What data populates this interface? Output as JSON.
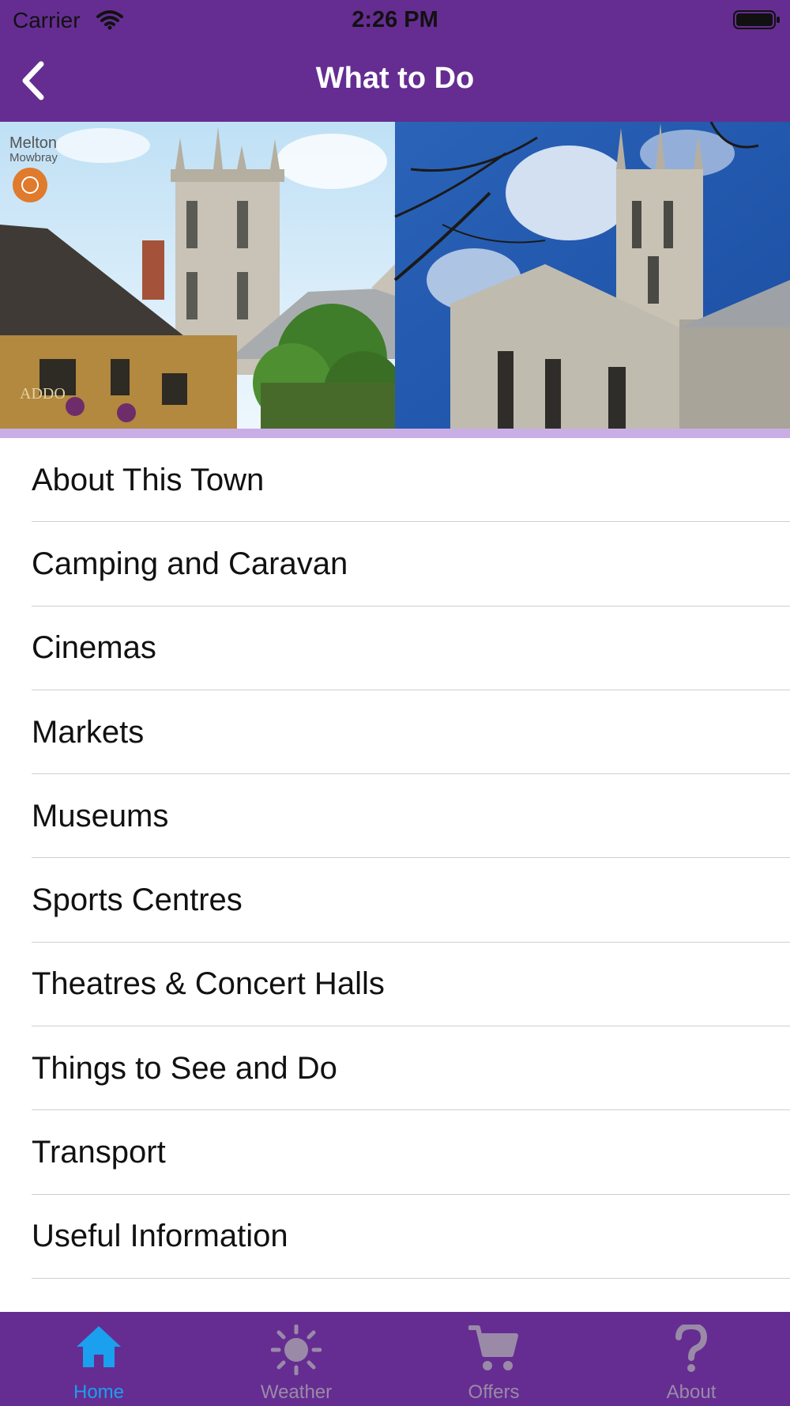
{
  "status_bar": {
    "carrier": "Carrier",
    "time": "2:26 PM"
  },
  "nav": {
    "title": "What to Do"
  },
  "banner": {
    "logo_text_line1": "Melton",
    "logo_text_line2": "Mowbray"
  },
  "menu": {
    "items": [
      {
        "label": "About This Town"
      },
      {
        "label": "Camping and Caravan"
      },
      {
        "label": "Cinemas"
      },
      {
        "label": "Markets"
      },
      {
        "label": "Museums"
      },
      {
        "label": "Sports Centres"
      },
      {
        "label": "Theatres & Concert Halls"
      },
      {
        "label": "Things to See and Do"
      },
      {
        "label": "Transport"
      },
      {
        "label": "Useful Information"
      }
    ]
  },
  "tabbar": {
    "tabs": [
      {
        "label": "Home",
        "icon": "home-icon",
        "active": true
      },
      {
        "label": "Weather",
        "icon": "sun-icon",
        "active": false
      },
      {
        "label": "Offers",
        "icon": "cart-icon",
        "active": false
      },
      {
        "label": "About",
        "icon": "question-icon",
        "active": false
      }
    ]
  },
  "colors": {
    "brand_purple": "#652d91",
    "accent_lavender": "#c9aee6",
    "active_tab": "#1aa0ee",
    "inactive_tab": "#9a8aa8"
  }
}
